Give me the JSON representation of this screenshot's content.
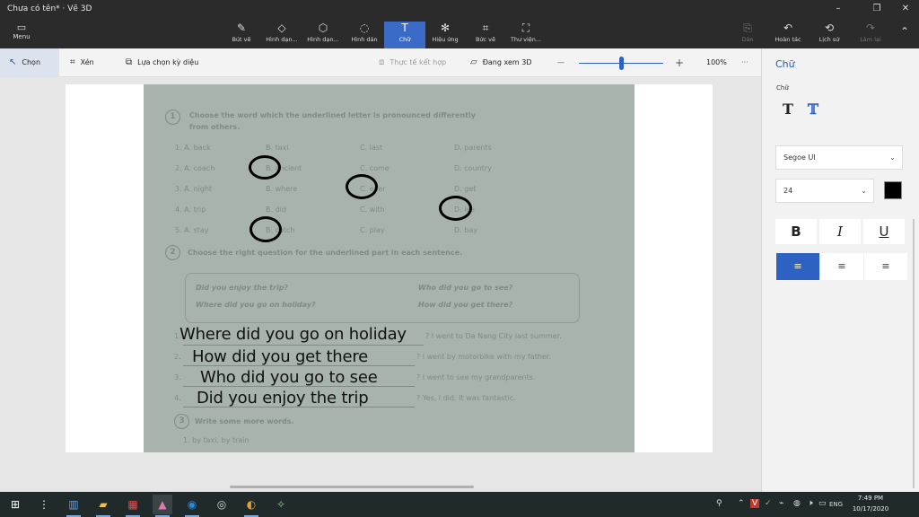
{
  "window": {
    "title": "Chưa có tên* · Vẽ 3D",
    "min_glyph": "–",
    "max_glyph": "❐",
    "close_glyph": "✕"
  },
  "ribbon": {
    "menu": {
      "icon": "▭",
      "label": "Menu"
    },
    "tools": [
      {
        "icon": "✎",
        "label": "Bút vẽ"
      },
      {
        "icon": "◇",
        "label": "Hình dạn..."
      },
      {
        "icon": "⬡",
        "label": "Hình dạn..."
      },
      {
        "icon": "◌",
        "label": "Hình dán"
      },
      {
        "icon": "T",
        "label": "Chữ"
      },
      {
        "icon": "✻",
        "label": "Hiệu ứng"
      },
      {
        "icon": "⌗",
        "label": "Bức vẽ"
      },
      {
        "icon": "⛶",
        "label": "Thư viện..."
      }
    ],
    "right": [
      {
        "icon": "⎘",
        "label": "Dán"
      },
      {
        "icon": "↶",
        "label": "Hoàn tác"
      },
      {
        "icon": "⟲",
        "label": "Lịch sử"
      },
      {
        "icon": "↷",
        "label": "Làm lại"
      }
    ],
    "collapse_icon": "⌃"
  },
  "toolbar": {
    "select": {
      "icon": "↖",
      "label": "Chọn"
    },
    "crop": {
      "icon": "⌗",
      "label": "Xén"
    },
    "magic": {
      "icon": "⧉",
      "label": "Lựa chọn kỳ diệu"
    },
    "mixed": {
      "icon": "⧈",
      "label": "Thực tế kết hợp"
    },
    "view3d": {
      "icon": "▱",
      "label": "Đang xem 3D"
    },
    "zoom_out": "—",
    "zoom_in": "+",
    "zoom_level": "100%",
    "more": "···",
    "zoom_fraction": 0.5
  },
  "worksheet": {
    "ex1_number": "1",
    "ex1_title": "Choose the word which the underlined letter is pronounced differently",
    "ex1_title2": "from others.",
    "rows": [
      [
        "1.  A. back",
        "B. taxi",
        "C. last",
        "D. parents"
      ],
      [
        "2.  A. coach",
        "B. ancient",
        "C. come",
        "D. country"
      ],
      [
        "3.  A. night",
        "B. where",
        "C. ever",
        "D. get"
      ],
      [
        "4.  A. trip",
        "B. did",
        "C. with",
        "D. ice"
      ],
      [
        "5.  A. stay",
        "B. catch",
        "C. play",
        "D. bay"
      ]
    ],
    "ex2_number": "2",
    "ex2_title": "Choose the right question for the underlined part in each sentence.",
    "box": [
      "Did you enjoy the trip?",
      "Who did you go to see?",
      "Where did you go on holiday?",
      "How did you get there?"
    ],
    "answers": [
      {
        "num": "1.",
        "tail": "? I went to Da Nang City last summer."
      },
      {
        "num": "2.",
        "tail": "? I went by motorbike with my father."
      },
      {
        "num": "3.",
        "tail": "? I went to see my grandparents."
      },
      {
        "num": "4.",
        "tail": "? Yes, I did. It was fantastic."
      }
    ],
    "ex3_number": "3",
    "ex3_title": "Write some more words.",
    "ex3_item": "1. by taxi, by train",
    "handwriting": [
      "Where did you go on holiday",
      "How did you get there",
      "Who did you go to see",
      "Did you enjoy the trip"
    ]
  },
  "panel": {
    "title": "Chữ",
    "sub": "Chữ",
    "text2d_icon": "T",
    "text3d_icon": "𝕋",
    "font": "Segoe UI",
    "size": "24",
    "chevron": "⌄",
    "bold": "B",
    "italic": "I",
    "underline": "U",
    "align_left": "≡",
    "align_center": "≡",
    "align_right": "≡"
  },
  "taskbar": {
    "start_icon": "⊞",
    "icons": [
      "⋮",
      "▥",
      "▰",
      "▦",
      "▲",
      "◉",
      "◎",
      "◐",
      "✧"
    ],
    "tray": [
      "⚲",
      "⌃",
      "V",
      "✓",
      "⌁",
      "◍",
      "🕨",
      "▭"
    ],
    "lang": "ENG",
    "time": "7:49 PM",
    "date": "10/17/2020"
  },
  "colors": {
    "accent": "#2d62c3",
    "title_bar": "#2b2b2b",
    "taskbar": "#202a2a",
    "text_color_swatch": "#000000"
  }
}
